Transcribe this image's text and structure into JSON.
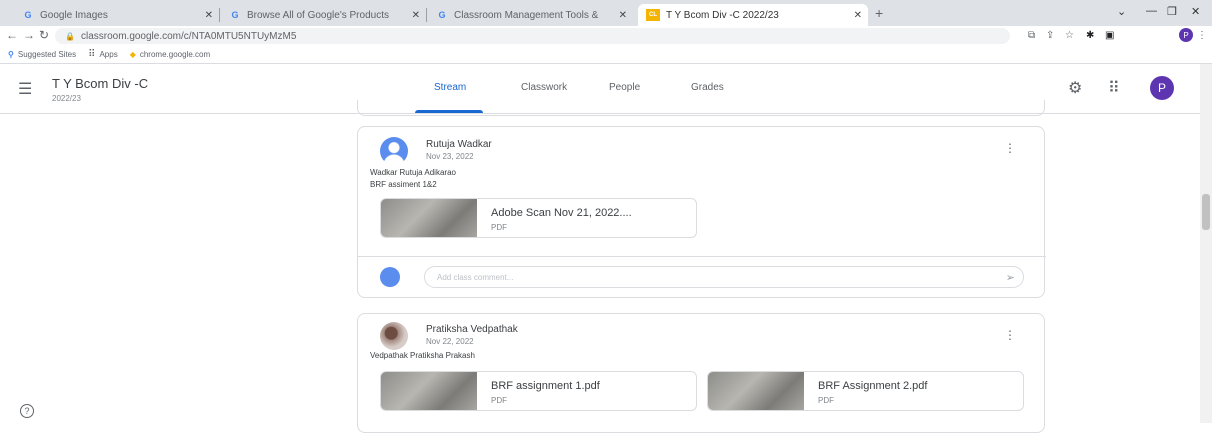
{
  "browser": {
    "tabs": [
      {
        "label": "Google Images",
        "icon": "G"
      },
      {
        "label": "Browse All of Google's Products",
        "icon": "G"
      },
      {
        "label": "Classroom Management Tools &",
        "icon": "G"
      },
      {
        "label": "T Y Bcom Div -C 2022/23",
        "icon": "CL"
      }
    ],
    "url": "classroom.google.com/c/NTA0MTU5NTUyMzM5",
    "profile_initial": "P",
    "bookmarks": {
      "suggested": "Suggested Sites",
      "apps": "Apps",
      "chrome": "chrome.google.com"
    }
  },
  "header": {
    "class_name": "T Y Bcom Div -C",
    "class_year": "2022/23",
    "tabs": [
      "Stream",
      "Classwork",
      "People",
      "Grades"
    ],
    "avatar_initial": "P"
  },
  "posts": [
    {
      "author": "Rutuja Wadkar",
      "date": "Nov 23, 2022",
      "lines": [
        "Wadkar Rutuja Adikarao",
        "BRF assiment 1&2"
      ],
      "attachments": [
        {
          "title": "Adobe Scan Nov 21, 2022....",
          "type": "PDF"
        }
      ],
      "comment_placeholder": "Add class comment..."
    },
    {
      "author": "Pratiksha Vedpathak",
      "date": "Nov 22, 2022",
      "lines": [
        "Vedpathak Pratiksha Prakash"
      ],
      "attachments": [
        {
          "title": "BRF assignment 1.pdf",
          "type": "PDF"
        },
        {
          "title": "BRF Assignment 2.pdf",
          "type": "PDF"
        }
      ]
    }
  ],
  "colors": {
    "accent": "#1967d2",
    "avatar": "#5e35b1"
  }
}
